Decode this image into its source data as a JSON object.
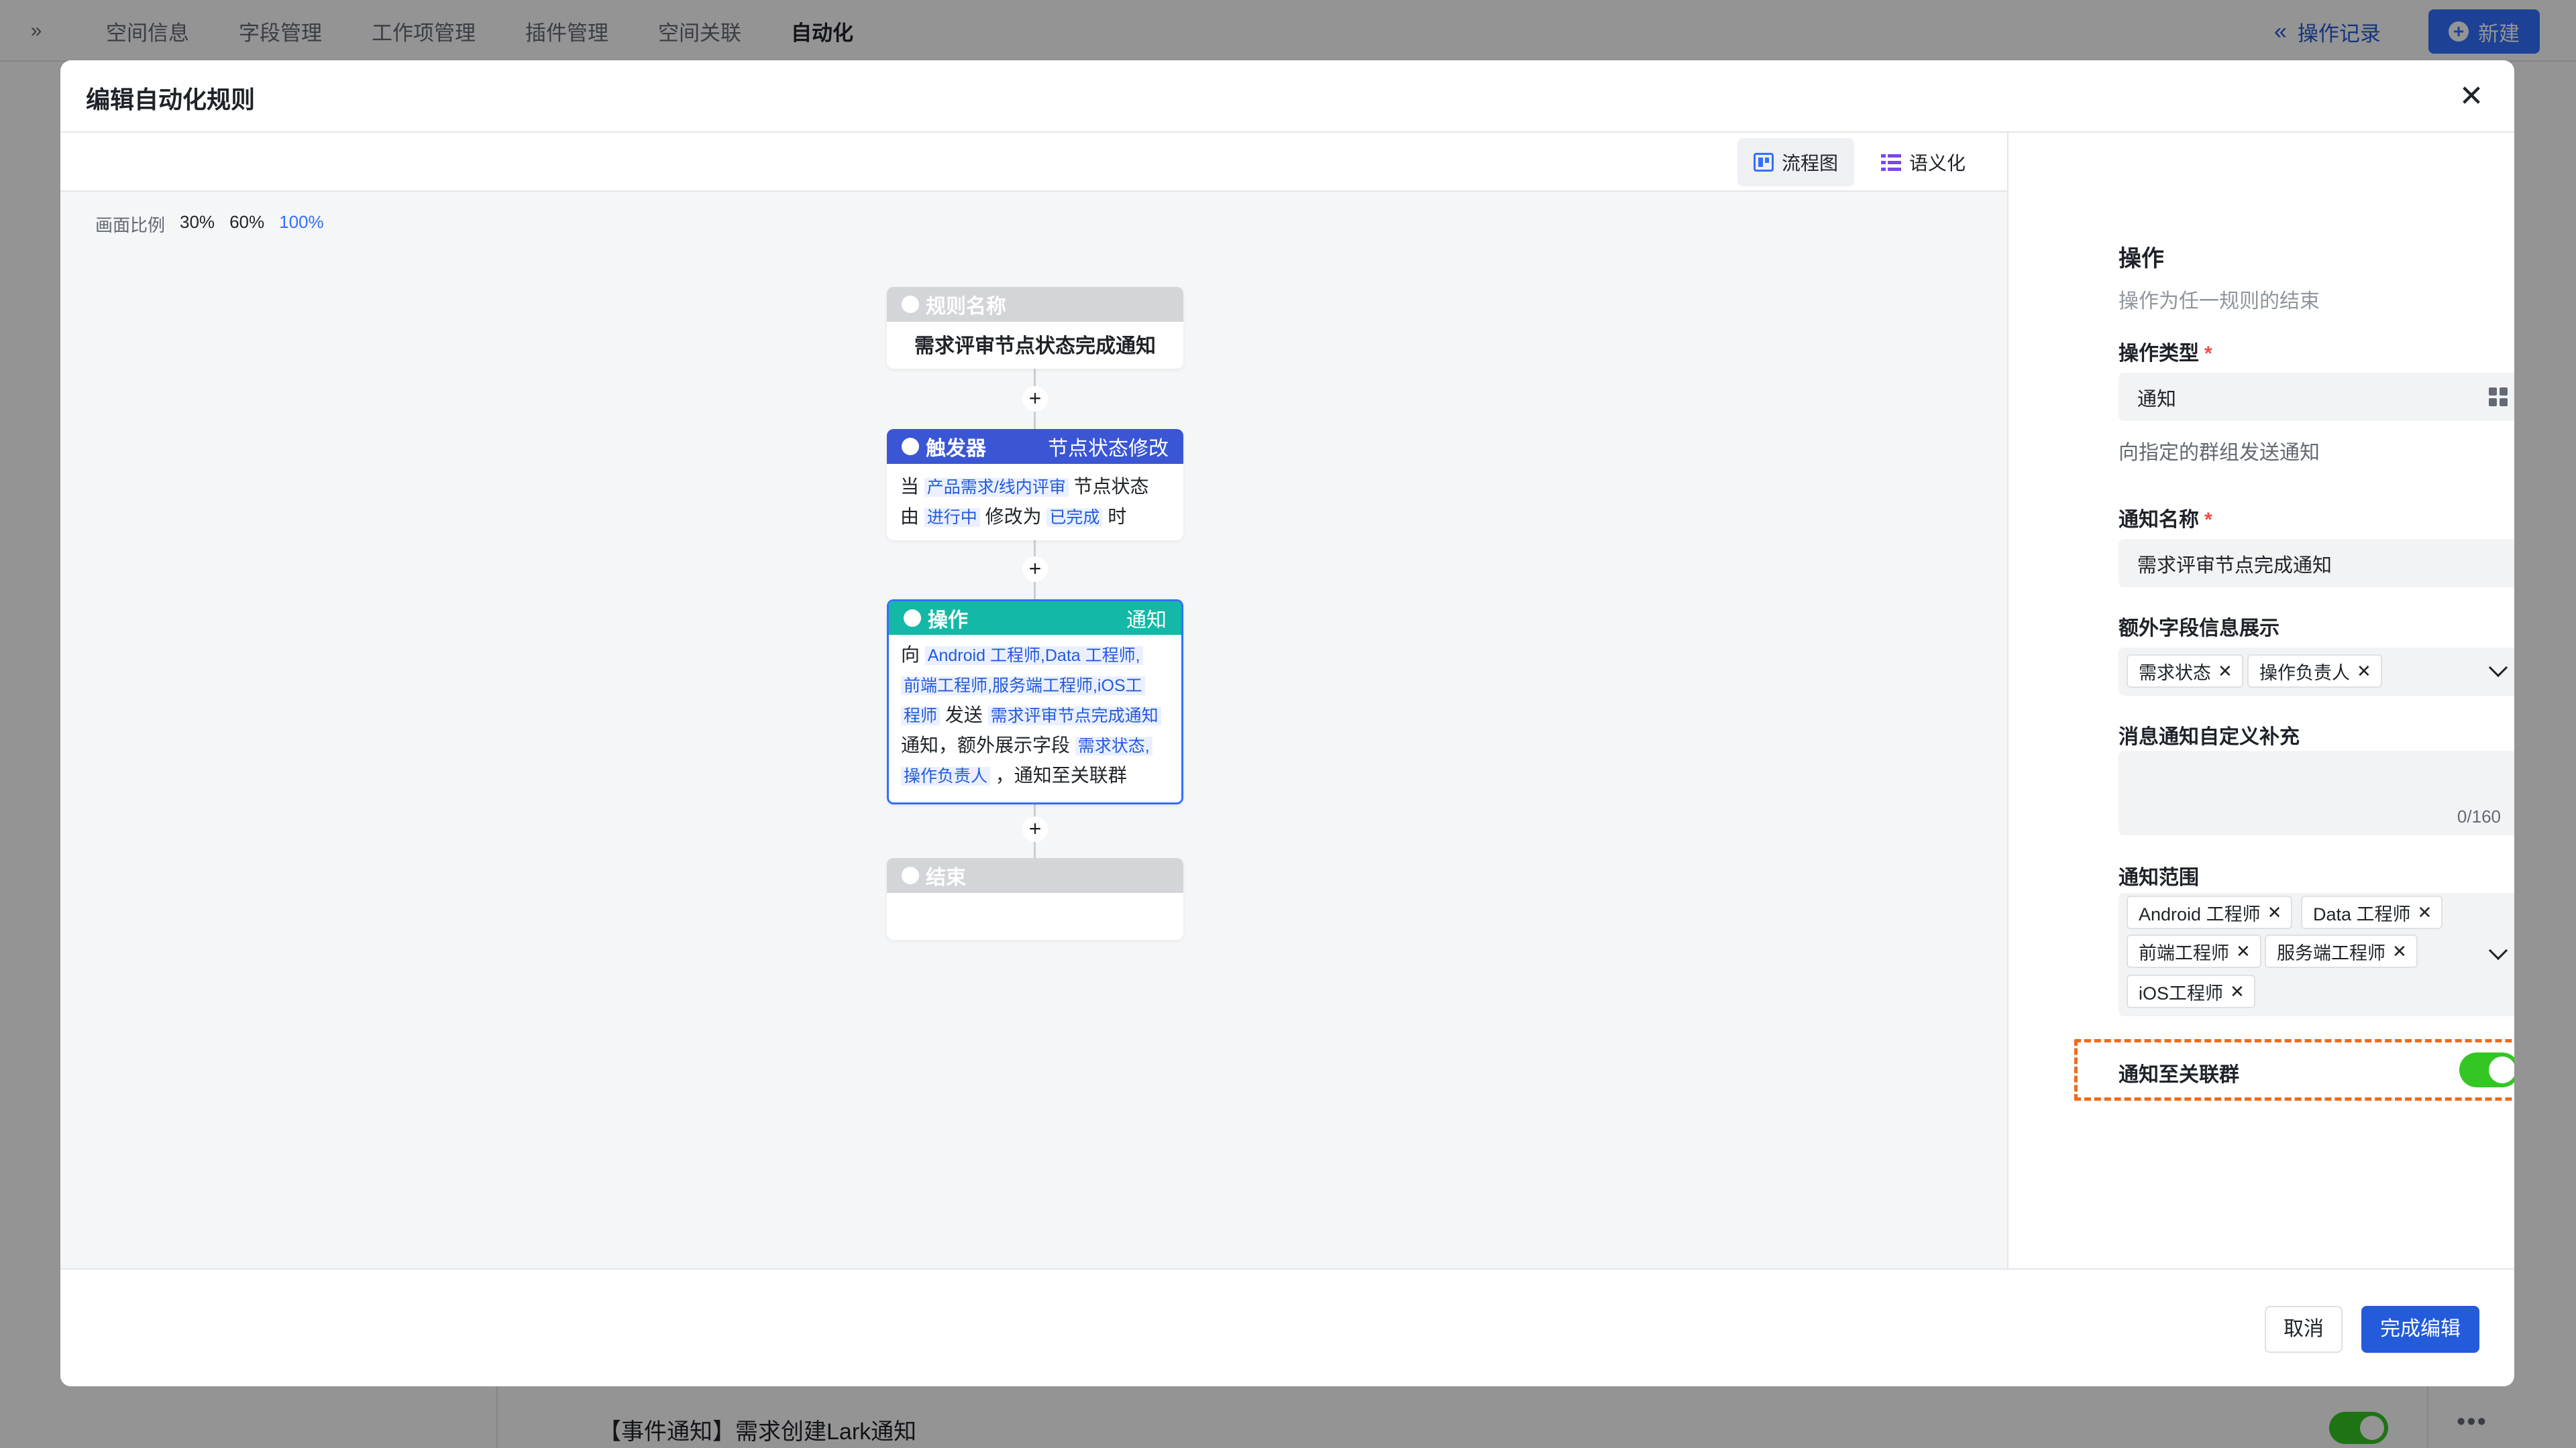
{
  "bg_nav": {
    "tabs": [
      "空间信息",
      "字段管理",
      "工作项管理",
      "插件管理",
      "空间关联",
      "自动化"
    ],
    "active_tab": "自动化",
    "oplog_label": "操作记录",
    "new_label": "新建",
    "row_title": "【事件通知】需求创建Lark通知"
  },
  "modal": {
    "title": "编辑自动化规则",
    "view_flow_label": "流程图",
    "view_semantic_label": "语义化",
    "scale_label": "画面比例",
    "scales": [
      "30%",
      "60%",
      "100%"
    ],
    "active_scale": "100%"
  },
  "flow": {
    "rule": {
      "head": "规则名称",
      "name": "需求评审节点状态完成通知"
    },
    "trigger": {
      "head": "触发器",
      "tag": "节点状态修改",
      "t1": "当",
      "node": "产品需求/线内评审",
      "t2": "节点状态",
      "t3": "由",
      "from": "进行中",
      "t4": "修改为",
      "to": "已完成",
      "t5": "时"
    },
    "action": {
      "head": "操作",
      "tag": "通知",
      "t1": "向",
      "targets_a": "Android 工程师,Data 工程师,",
      "targets_b": "前端工程师,服务端工程师,iOS工",
      "targets_c": "程师",
      "t2": "发送",
      "notice_name": "需求评审节点完成通知",
      "t3": "通知，额外展示字段",
      "fields_a": "需求状态,",
      "fields_b": "操作负责人",
      "t4": "，通知至关联群"
    },
    "end": {
      "head": "结束"
    }
  },
  "panel": {
    "title": "操作",
    "desc": "操作为任一规则的结束",
    "type_label": "操作类型",
    "type_value": "通知",
    "type_hint": "向指定的群组发送通知",
    "name_label": "通知名称",
    "name_value": "需求评审节点完成通知",
    "extra_label": "额外字段信息展示",
    "extra_chips": [
      "需求状态",
      "操作负责人"
    ],
    "custom_label": "消息通知自定义补充",
    "custom_counter": "0/160",
    "scope_label": "通知范围",
    "scope_chips": [
      "Android 工程师",
      "Data 工程师",
      "前端工程师",
      "服务端工程师",
      "iOS工程师"
    ],
    "sync_label": "通知至关联群",
    "sync_enabled": true
  },
  "footer": {
    "cancel_label": "取消",
    "done_label": "完成编辑"
  },
  "colors": {
    "accent": "#3370ff",
    "trigger": "#3a56d4",
    "action": "#14b8a6",
    "toggle": "#34c724",
    "highlight_box": "#ef6c1b"
  }
}
